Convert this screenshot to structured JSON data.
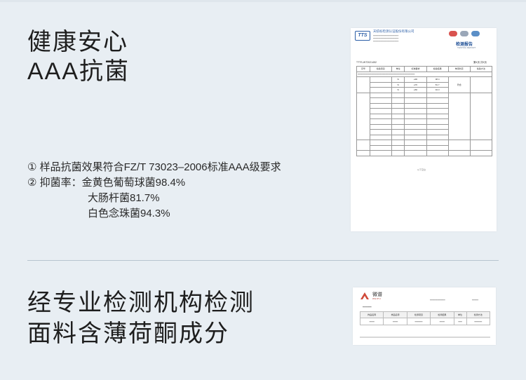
{
  "section1": {
    "title_line1": "健康安心",
    "title_line2": "AAA抗菌",
    "points": [
      "① 样品抗菌效果符合FZ/T 73023–2006标准AAA级要求",
      "② 抑菌率：金黄色葡萄球菌98.4%",
      "大肠杆菌81.7%",
      "白色念珠菌94.3%"
    ]
  },
  "section2": {
    "title_line1": "经专业检测机构检测",
    "title_line2": "面料含薄荷酮成分"
  },
  "report1": {
    "logo_text": "TTS",
    "org_name": "天纺标检测认证股份有限公司",
    "title": "检测报告",
    "title_en": "TESTING REPORT",
    "report_no": "TTTS-WT2021452",
    "page": "第4页 共5页",
    "header": [
      "序号",
      "检验项目",
      "单位",
      "标准要求",
      "检验结果",
      "单项判定",
      "检验方法"
    ],
    "rows": [
      [
        "",
        "",
        "%",
        "≥90",
        "98.4",
        "",
        ""
      ],
      [
        "",
        "",
        "%",
        "≥70",
        "81.7",
        "符合",
        ""
      ],
      [
        "",
        "",
        "%",
        "≥60",
        "94.3",
        "",
        ""
      ]
    ],
    "footer": "以下空白"
  },
  "report2": {
    "brand": "微谱",
    "brand_en": "WEIPU",
    "header": [
      "样品名称",
      "样品名称",
      "检测项目",
      "检测结果",
      "单位",
      "检测方法"
    ]
  },
  "colors": {
    "background": "#e8eef3",
    "heading": "#1e1e1e",
    "divider": "#b7c4cf",
    "report_blue": "#2b5ea7"
  }
}
